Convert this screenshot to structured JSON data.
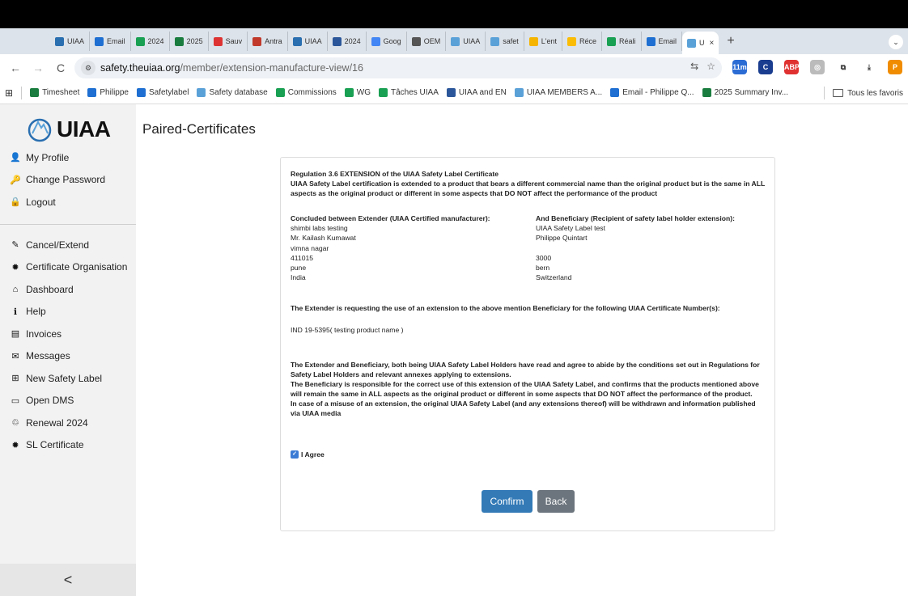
{
  "browser": {
    "tabs": [
      {
        "label": "UIAA",
        "color": "#2a6fb0"
      },
      {
        "label": "Email",
        "color": "#1e6fd1"
      },
      {
        "label": "2024",
        "color": "#1aa053"
      },
      {
        "label": "2025",
        "color": "#1a7d3f"
      },
      {
        "label": "Sauv",
        "color": "#d33"
      },
      {
        "label": "Antra",
        "color": "#c0392b"
      },
      {
        "label": "UIAA",
        "color": "#2a6fb0"
      },
      {
        "label": "2024",
        "color": "#2b579a"
      },
      {
        "label": "Goog",
        "color": "#4285f4"
      },
      {
        "label": "OEM",
        "color": "#555"
      },
      {
        "label": "UIAA",
        "color": "#5aa1d8"
      },
      {
        "label": "safet",
        "color": "#5aa1d8"
      },
      {
        "label": "L'ent",
        "color": "#f4b400"
      },
      {
        "label": "Réce",
        "color": "#fbbc05"
      },
      {
        "label": "Réali",
        "color": "#1aa053"
      },
      {
        "label": "Email",
        "color": "#1e6fd1"
      }
    ],
    "active_tab": {
      "label": "U",
      "close": "×"
    },
    "new_tab": "+",
    "tab_menu": "⌄",
    "url_host": "safety.theuiaa.org",
    "url_path": "/member/extension-manufacture-view/16",
    "back": "←",
    "forward": "→",
    "reload": "C",
    "site_info": "⚙",
    "translate": "⇆",
    "star": "☆",
    "extensions": [
      {
        "label": "11m",
        "color": "#2b6cd4"
      },
      {
        "label": "C",
        "color": "#1a3d8f"
      },
      {
        "label": "ABP",
        "color": "#e03131"
      },
      {
        "label": "◎",
        "color": "#bbbbbb"
      },
      {
        "label": "⧉",
        "color": "#333333"
      },
      {
        "label": "⤓",
        "color": "#333333"
      },
      {
        "label": "P",
        "color": "#f08c00"
      },
      {
        "label": "⋮",
        "color": "#333333"
      }
    ],
    "apps_icon": "⊞",
    "bookmarks": [
      {
        "label": "Timesheet",
        "color": "#1a7d3f"
      },
      {
        "label": "Philippe",
        "color": "#1e6fd1"
      },
      {
        "label": "Safetylabel",
        "color": "#1e6fd1"
      },
      {
        "label": "Safety database",
        "color": "#5aa1d8"
      },
      {
        "label": "Commissions",
        "color": "#1aa053"
      },
      {
        "label": "WG",
        "color": "#1aa053"
      },
      {
        "label": "Tâches UIAA",
        "color": "#1aa053"
      },
      {
        "label": "UIAA and EN",
        "color": "#2b579a"
      },
      {
        "label": "UIAA MEMBERS A...",
        "color": "#5aa1d8"
      },
      {
        "label": "Email - Philippe Q...",
        "color": "#1e6fd1"
      },
      {
        "label": "2025 Summary Inv...",
        "color": "#1a7d3f"
      }
    ],
    "all_bookmarks": "Tous les favoris"
  },
  "sidebar": {
    "logo": "UIAA",
    "profile_items": [
      {
        "label": "My Profile",
        "icon": "👤"
      },
      {
        "label": "Change Password",
        "icon": "🔑"
      },
      {
        "label": "Logout",
        "icon": "🔒"
      }
    ],
    "nav_items": [
      {
        "label": "Cancel/Extend",
        "icon": "✎"
      },
      {
        "label": "Certificate Organisation",
        "icon": "✹"
      },
      {
        "label": "Dashboard",
        "icon": "⌂"
      },
      {
        "label": "Help",
        "icon": "ℹ"
      },
      {
        "label": "Invoices",
        "icon": "▤"
      },
      {
        "label": "Messages",
        "icon": "✉"
      },
      {
        "label": "New Safety Label",
        "icon": "⊞"
      },
      {
        "label": "Open DMS",
        "icon": "▭"
      },
      {
        "label": "Renewal 2024",
        "icon": "♲"
      },
      {
        "label": "SL Certificate",
        "icon": "✹"
      }
    ],
    "collapse": "<"
  },
  "page": {
    "title": "Paired-Certificates",
    "regulation_title": "Regulation 3.6 EXTENSION of the UIAA Safety Label Certificate",
    "regulation_text": "UIAA Safety Label certification is extended to a product that bears a different commercial name than the original product but is the same in ALL aspects as the original product or different in some aspects that DO NOT affect the performance of the product",
    "extender": {
      "heading": "Concluded between Extender (UIAA Certified manufacturer):",
      "lines": [
        "shimbi labs testing",
        "Mr. Kailash Kumawat",
        "vimna nagar",
        "411015",
        "pune",
        "India"
      ]
    },
    "beneficiary": {
      "heading": "And Beneficiary (Recipient of safety label holder extension):",
      "lines": [
        "UIAA Safety Label test",
        "Philippe Quintart",
        "",
        "3000",
        "bern",
        "Switzerland"
      ]
    },
    "request_text": "The Extender is requesting the use of an extension to the above mention Beneficiary for the following UIAA Certificate Number(s):",
    "certificate": "IND 19-5395( testing product name )",
    "conditions": [
      "The Extender and Beneficiary, both being UIAA Safety Label Holders have read and agree to abide by the conditions set out in Regulations for Safety Label Holders and relevant annexes applying to extensions.",
      "The Beneficiary is responsible for the correct use of this extension of the UIAA Safety Label, and confirms that the products mentioned above will remain the same in ALL aspects as the original product or different in some aspects that DO NOT affect the performance of the product.",
      "In case of a misuse of an extension, the original UIAA Safety Label (and any extensions thereof) will be withdrawn and information published via UIAA media"
    ],
    "agree_label": "I Agree",
    "agree_checked": true,
    "confirm_label": "Confirm",
    "back_label": "Back"
  },
  "colors": {
    "confirm": "#337ab7",
    "back": "#6c757d",
    "checkbox": "#3a7bd5",
    "sidebar_bg": "#f2f2f2"
  }
}
